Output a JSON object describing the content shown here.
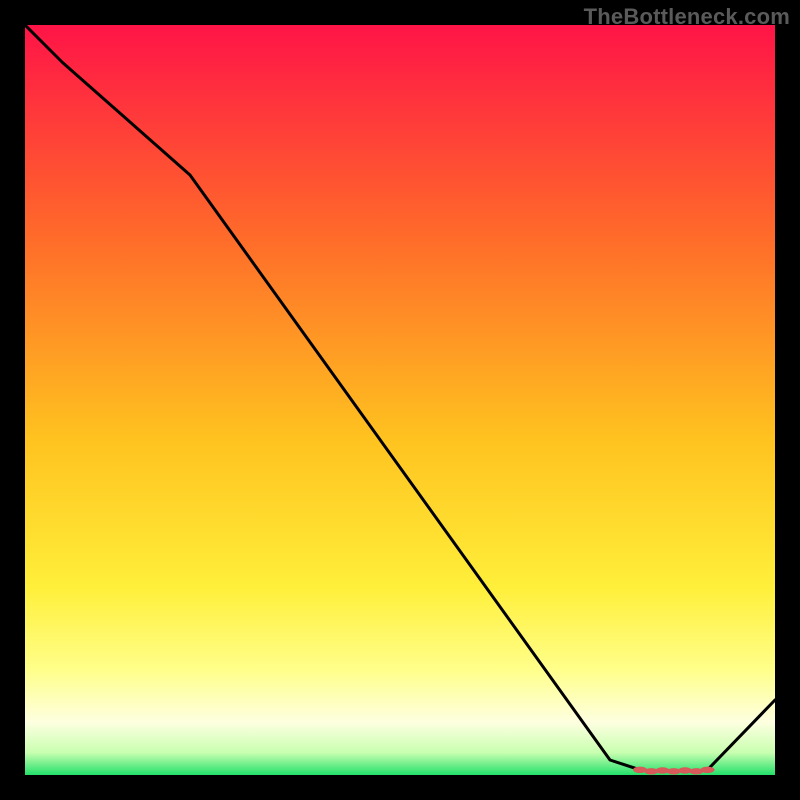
{
  "watermark": "TheBottleneck.com",
  "colors": {
    "background": "#000000",
    "gradient_top": "#ff1447",
    "gradient_mid1": "#ff7a1f",
    "gradient_mid2": "#ffd400",
    "gradient_mid3": "#ffff55",
    "gradient_mid4": "#fdffd4",
    "gradient_bottom": "#22e06a",
    "line": "#000000",
    "marker": "#d85a5a"
  },
  "chart_data": {
    "type": "line",
    "x": [
      0,
      5,
      22,
      78,
      82,
      83.5,
      85,
      86.5,
      88,
      89.5,
      91,
      100
    ],
    "y": [
      100,
      95,
      80,
      2,
      0.7,
      0.5,
      0.6,
      0.5,
      0.6,
      0.5,
      0.7,
      10
    ],
    "markers_x": [
      82,
      83.5,
      85,
      86.5,
      88,
      89.5,
      91
    ],
    "markers_y": [
      0.7,
      0.5,
      0.6,
      0.5,
      0.6,
      0.5,
      0.7
    ],
    "xlabel": "",
    "ylabel": "",
    "title": "",
    "xlim": [
      0,
      100
    ],
    "ylim": [
      0,
      100
    ]
  }
}
